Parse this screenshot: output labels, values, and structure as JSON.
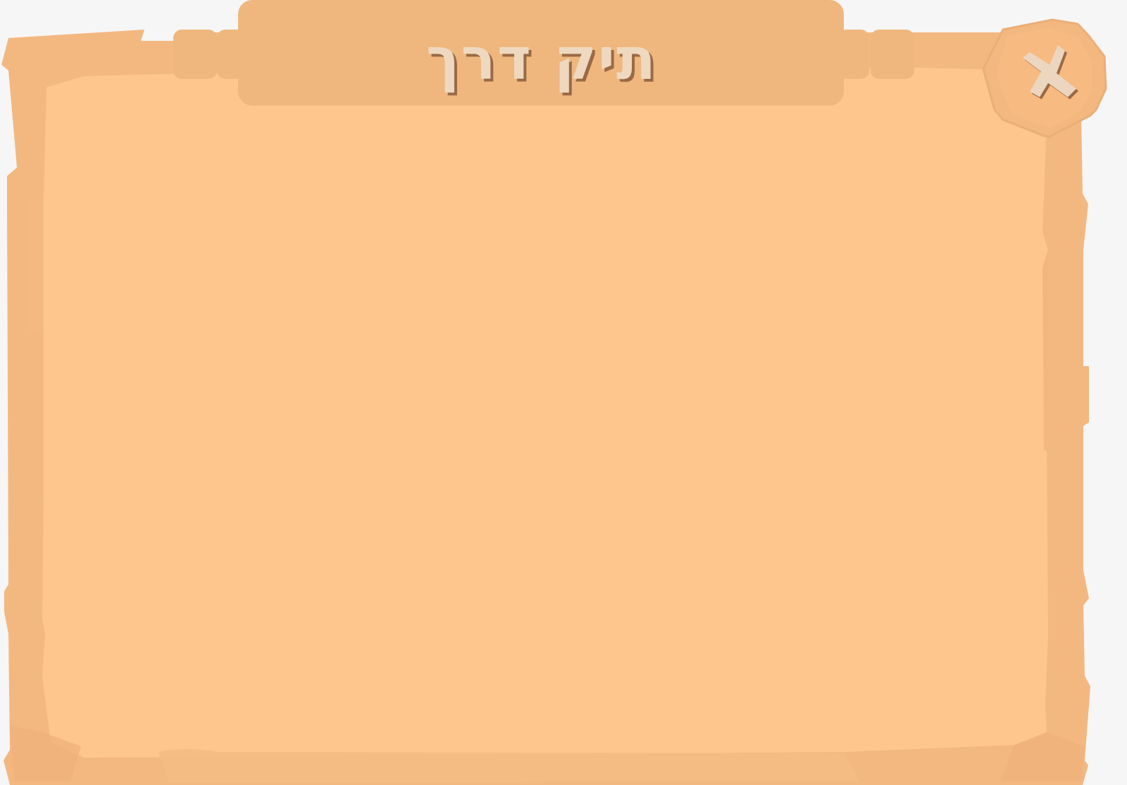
{
  "dialog": {
    "title": "תיק דרך"
  },
  "close_button": {
    "icon": "close-icon"
  },
  "colors": {
    "background": "#f6f6f6",
    "parchment": "#fec68c",
    "frame": "#f3b880",
    "title_banner": "#efb77e",
    "title_text": "#eed9c0",
    "title_shadow": "#9a6a45",
    "close_x": "#ecd6bf"
  }
}
